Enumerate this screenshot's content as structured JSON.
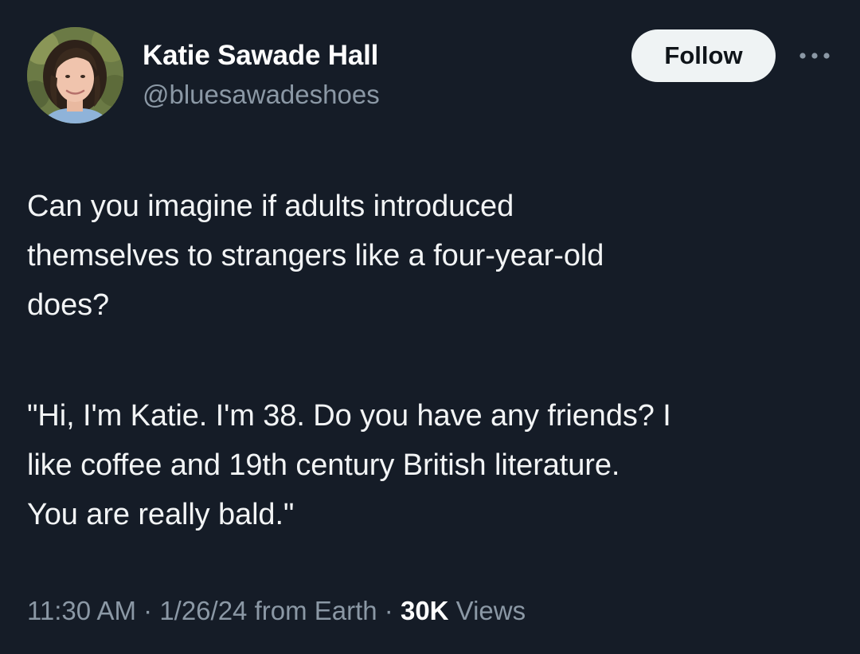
{
  "user": {
    "display_name": "Katie Sawade Hall",
    "handle": "@bluesawadeshoes",
    "avatar_icon": "profile-photo"
  },
  "actions": {
    "follow_label": "Follow",
    "more_icon": "more-horizontal-icon"
  },
  "tweet": {
    "paragraph1_lines": [
      "Can you imagine if adults introduced",
      "themselves to strangers like a four-year-old",
      "does?"
    ],
    "paragraph2_lines": [
      "\"Hi, I'm Katie. I'm 38. Do you have any friends? I",
      "like coffee and 19th century British literature.",
      "You are really bald.\""
    ]
  },
  "meta": {
    "time": "11:30 AM",
    "sep1": " · ",
    "date": "1/26/24",
    "source": " from Earth",
    "sep2": " · ",
    "views_count": "30K",
    "views_label": " Views"
  },
  "colors": {
    "background": "#151c27",
    "secondary_text": "#8b98a5",
    "follow_bg": "#eff3f4"
  }
}
